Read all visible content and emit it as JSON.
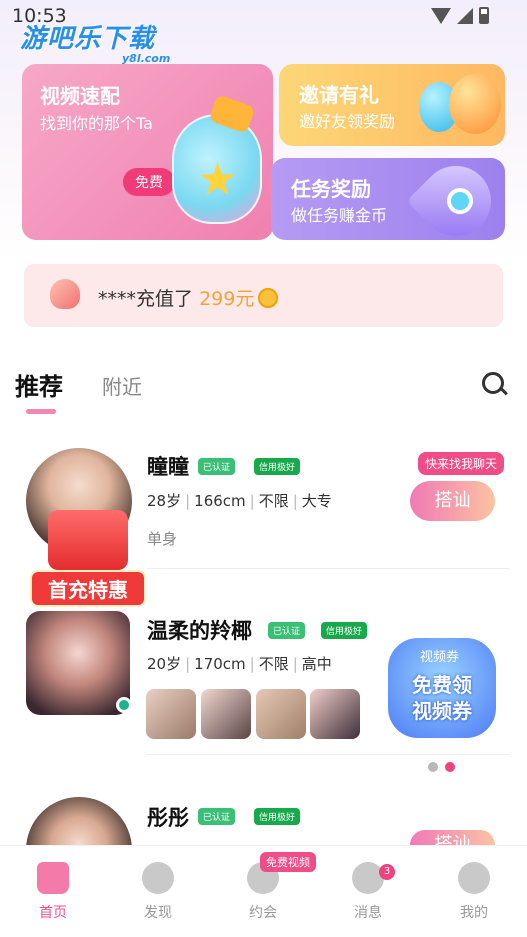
{
  "status_bar": {
    "time": "10:53"
  },
  "watermark": {
    "brand": "游吧乐下载",
    "domain": "y8l.com"
  },
  "cards": {
    "video": {
      "title": "视频速配",
      "subtitle": "找到你的那个Ta",
      "badge": "免费"
    },
    "invite": {
      "title": "邀请有礼",
      "subtitle": "邀好友领奖励"
    },
    "task": {
      "title": "任务奖励",
      "subtitle": "做任务赚金币"
    }
  },
  "recharge": {
    "prefix": "****充值了",
    "amount": "299元"
  },
  "tabs": {
    "recommend": "推荐",
    "nearby": "附近"
  },
  "users": [
    {
      "name": "瞳瞳",
      "verified": "已认证",
      "credit": "信用极好",
      "age": "28岁",
      "height": "166cm",
      "income": "不限",
      "education": "大专",
      "marital": "单身",
      "chat_bubble": "快来找我聊天",
      "chat_button": "搭讪"
    },
    {
      "name": "温柔的羚椰",
      "verified": "已认证",
      "credit": "信用极好",
      "age": "20岁",
      "height": "170cm",
      "income": "不限",
      "education": "高中"
    },
    {
      "name": "彤彤",
      "verified": "已认证",
      "credit": "信用极好",
      "chat_button": "搭讪"
    }
  ],
  "promos": {
    "first_charge": "首充特惠",
    "coupon": "免费领视频券",
    "coupon_line1": "免费领",
    "coupon_line2": "视频券",
    "coupon_tag": "视频券"
  },
  "bottom_nav": [
    {
      "label": "首页",
      "icon": "home-icon",
      "active": true
    },
    {
      "label": "发现",
      "icon": "discover-icon"
    },
    {
      "label": "约会",
      "icon": "date-icon",
      "badge": "免费视频"
    },
    {
      "label": "消息",
      "icon": "message-icon",
      "count": "3"
    },
    {
      "label": "我的",
      "icon": "profile-icon"
    }
  ],
  "colors": {
    "accent": "#f3518c",
    "verify": "#3bbf77",
    "recharge_amount": "#f2a33a"
  }
}
